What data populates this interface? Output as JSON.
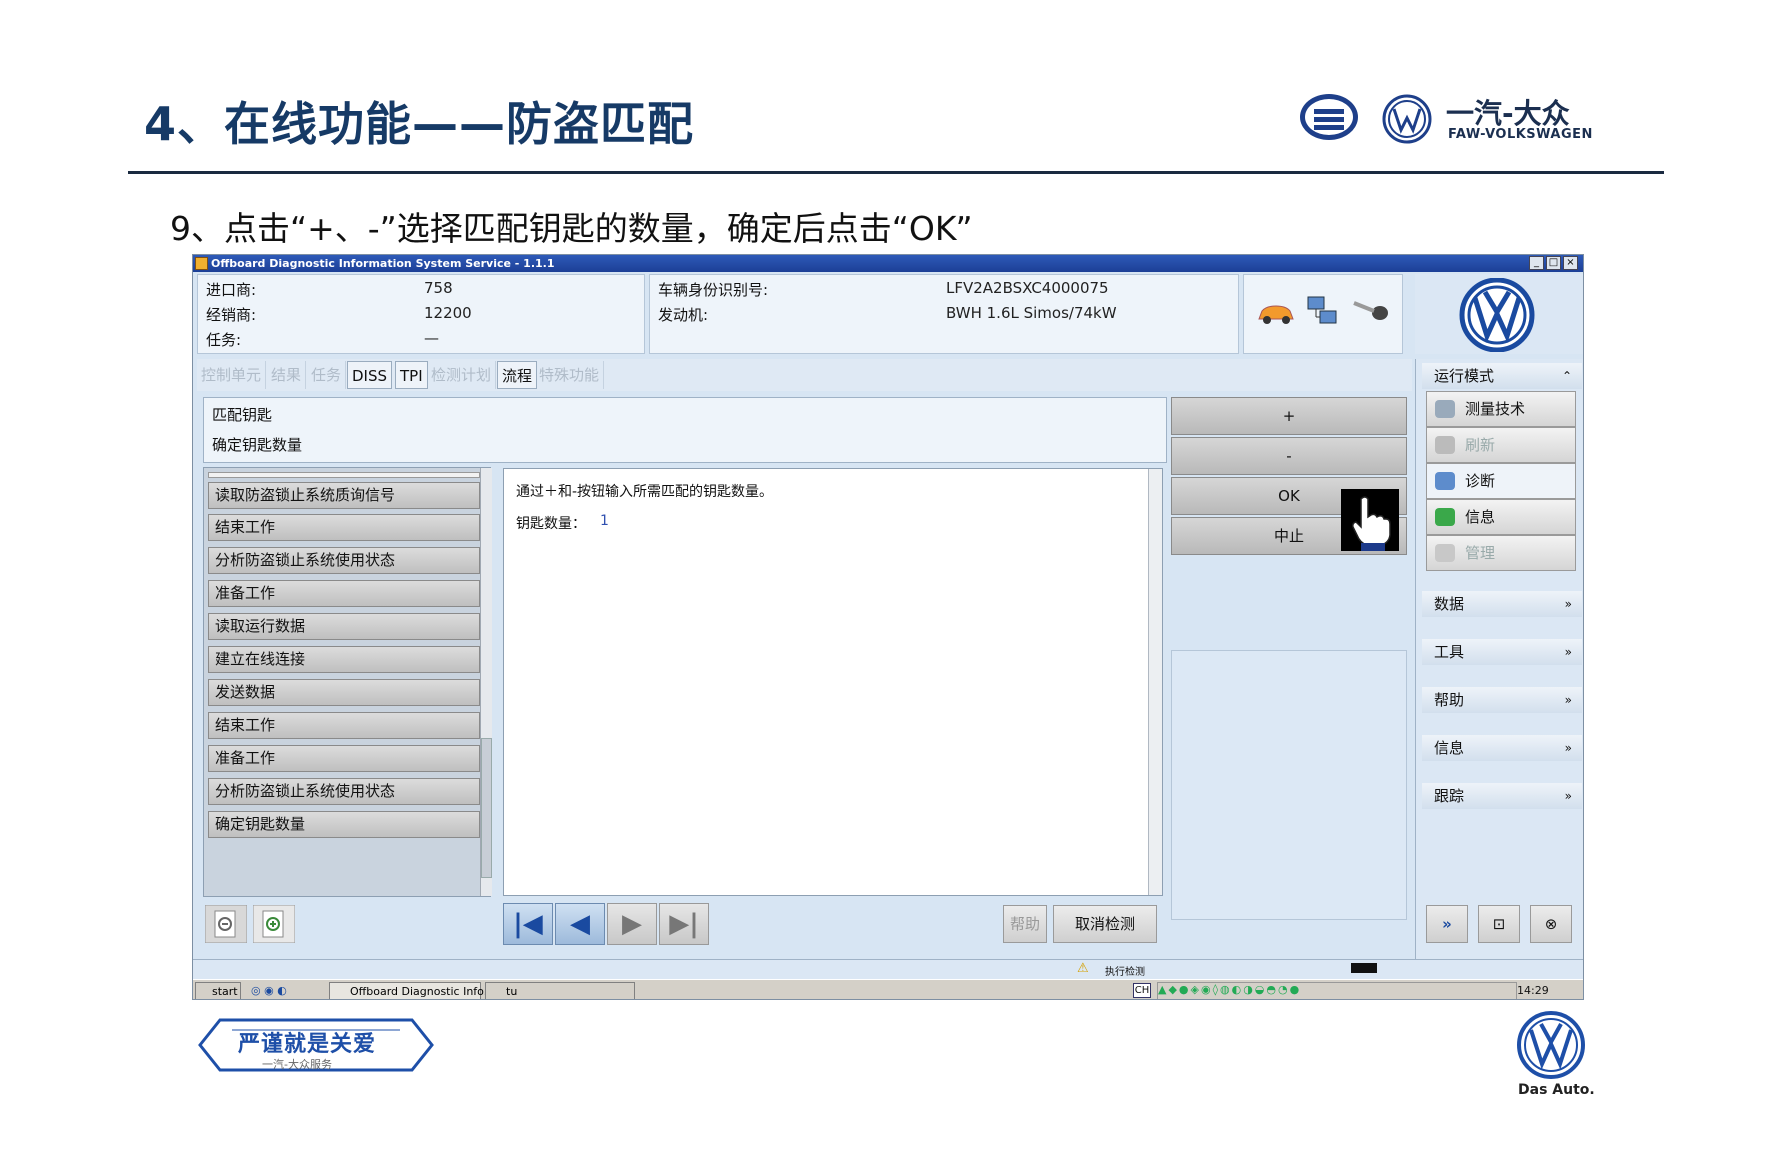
{
  "slide": {
    "title": "4、在线功能——防盗匹配",
    "subtitle": "9、点击“+、-”选择匹配钥匙的数量，确定后点击“OK”",
    "brand_cn": "一汽-大众",
    "brand_en": "FAW-VOLKSWAGEN",
    "das_auto": "Das Auto.",
    "bottom_logo_main": "严谨就是关爱",
    "bottom_logo_sub": "一汽-大众服务"
  },
  "window": {
    "title": "Offboard Diagnostic Information System Service - 1.1.1",
    "buttons": [
      "_",
      "□",
      "×"
    ]
  },
  "info_left": {
    "importer_label": "进口商:",
    "importer_value": "758",
    "dealer_label": "经销商:",
    "dealer_value": "12200",
    "task_label": "任务:",
    "task_value": "—"
  },
  "info_mid": {
    "vin_label": "车辆身份识别号:",
    "vin_value": "LFV2A2BSXC4000075",
    "engine_label": "发动机:",
    "engine_value": "BWH 1.6L Simos/74kW"
  },
  "tabs": [
    {
      "label": "控制单元",
      "enabled": false
    },
    {
      "label": "结果",
      "enabled": false
    },
    {
      "label": "任务",
      "enabled": false
    },
    {
      "label": "DISS",
      "enabled": true
    },
    {
      "label": "TPI",
      "enabled": true
    },
    {
      "label": "检测计划",
      "enabled": false
    },
    {
      "label": "流程",
      "enabled": true
    },
    {
      "label": "特殊功能",
      "enabled": false
    }
  ],
  "header": {
    "line1": "匹配钥匙",
    "line2": "确定钥匙数量"
  },
  "steps": [
    "读取防盗锁止系统质询信号",
    "结束工作",
    "分析防盗锁止系统使用状态",
    "准备工作",
    "读取运行数据",
    "建立在线连接",
    "发送数据",
    "结束工作",
    "准备工作",
    "分析防盗锁止系统使用状态",
    "确定钥匙数量"
  ],
  "content": {
    "instruction": "通过＋和-按钮输入所需匹配的钥匙数量。",
    "key_count_label": "钥匙数量：",
    "key_count_value": "1"
  },
  "actions": {
    "plus": "+",
    "minus": "-",
    "ok": "OK",
    "stop": "中止"
  },
  "side": {
    "mode_header": "运行模式",
    "mode_buttons": [
      {
        "label": "测量技术",
        "enabled": true,
        "icon": "gauge-icon"
      },
      {
        "label": "刷新",
        "enabled": false,
        "icon": "refresh-icon"
      },
      {
        "label": "诊断",
        "enabled": true,
        "icon": "stethoscope-icon"
      },
      {
        "label": "信息",
        "enabled": true,
        "icon": "info-books-icon"
      },
      {
        "label": "管理",
        "enabled": false,
        "icon": "gear-icon"
      }
    ],
    "sections": [
      "数据",
      "工具",
      "帮助",
      "信息",
      "跟踪"
    ]
  },
  "bottom": {
    "help": "帮助",
    "cancel": "取消检测",
    "nav": [
      "|◀",
      "◀",
      "▶",
      "▶|"
    ]
  },
  "status": {
    "text": "执行检测"
  },
  "taskbar": {
    "start": "start",
    "app": "Offboard Diagnostic Info...",
    "folder": "tu",
    "lang": "CH",
    "clock": "14:29"
  },
  "colors": {
    "title": "#163a66",
    "app_bg": "#d7e5f3",
    "titlebar": "#1c3f96",
    "vw_blue": "#1e4fa8"
  }
}
